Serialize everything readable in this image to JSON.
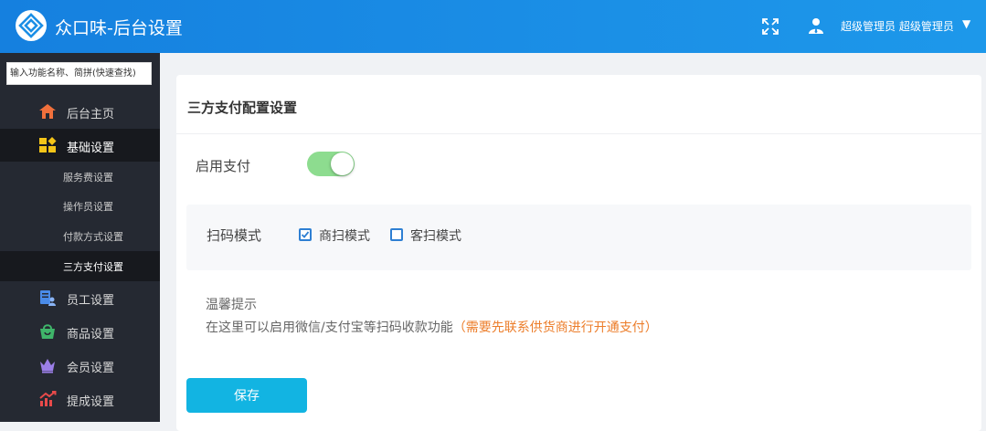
{
  "header": {
    "app_title": "众口味-后台设置",
    "user_name": "超级管理员 超级管理员",
    "user_caret": "▼"
  },
  "sidebar": {
    "search_placeholder": "输入功能名称、简拼(快速查找)",
    "items": [
      {
        "label": "后台主页",
        "icon": "home-icon",
        "color": "#f0703c"
      },
      {
        "label": "基础设置",
        "icon": "blocks-icon",
        "color": "#f5c518",
        "open": true
      },
      {
        "label": "员工设置",
        "icon": "staff-icon",
        "color": "#4a8be8"
      },
      {
        "label": "商品设置",
        "icon": "basket-icon",
        "color": "#3fb56a"
      },
      {
        "label": "会员设置",
        "icon": "crown-icon",
        "color": "#9b7fe8"
      },
      {
        "label": "提成设置",
        "icon": "trend-icon",
        "color": "#e84a4a"
      }
    ],
    "sub_items": [
      {
        "label": "服务费设置"
      },
      {
        "label": "操作员设置"
      },
      {
        "label": "付款方式设置"
      },
      {
        "label": "三方支付设置",
        "active": true
      }
    ]
  },
  "main": {
    "title": "三方支付配置设置",
    "enable_label": "启用支付",
    "enabled": true,
    "scan_label": "扫码模式",
    "options": [
      {
        "label": "商扫模式",
        "checked": true
      },
      {
        "label": "客扫模式",
        "checked": false
      }
    ],
    "tip_title": "温馨提示",
    "tip_text": "在这里可以启用微信/支付宝等扫码收款功能",
    "tip_highlight": "（需要先联系供货商进行开通支付）",
    "save_label": "保存"
  },
  "colors": {
    "header": "#1b8fe6",
    "sidebar": "#252932",
    "toggle_on": "#8ddc8f",
    "save_button": "#12b4e2",
    "highlight": "#ec7d2a",
    "checkbox": "#2e7fd3"
  }
}
